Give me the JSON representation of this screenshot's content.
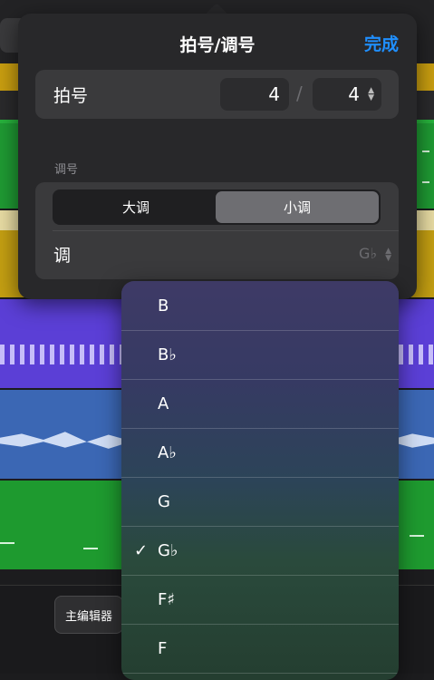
{
  "background": {
    "main_editor_button": "主编辑器"
  },
  "panel": {
    "title": "拍号/调号",
    "done_label": "完成",
    "time_signature": {
      "label": "拍号",
      "numerator": "4",
      "separator": "/",
      "denominator": "4"
    },
    "key_section_label": "调号",
    "mode_segments": [
      "大调",
      "小调"
    ],
    "selected_mode": "小调",
    "key_label": "调",
    "key_value": "G♭"
  },
  "key_options": [
    "B",
    "B♭",
    "A",
    "A♭",
    "G",
    "G♭",
    "F♯",
    "F"
  ],
  "selected_key": "G♭",
  "icons": {
    "check": "checkmark-icon",
    "updown": "chevron-up-down-icon"
  },
  "colors": {
    "accent": "#1f8fff",
    "panel_bg": "#28282a",
    "row_bg": "#3a3a3c"
  }
}
